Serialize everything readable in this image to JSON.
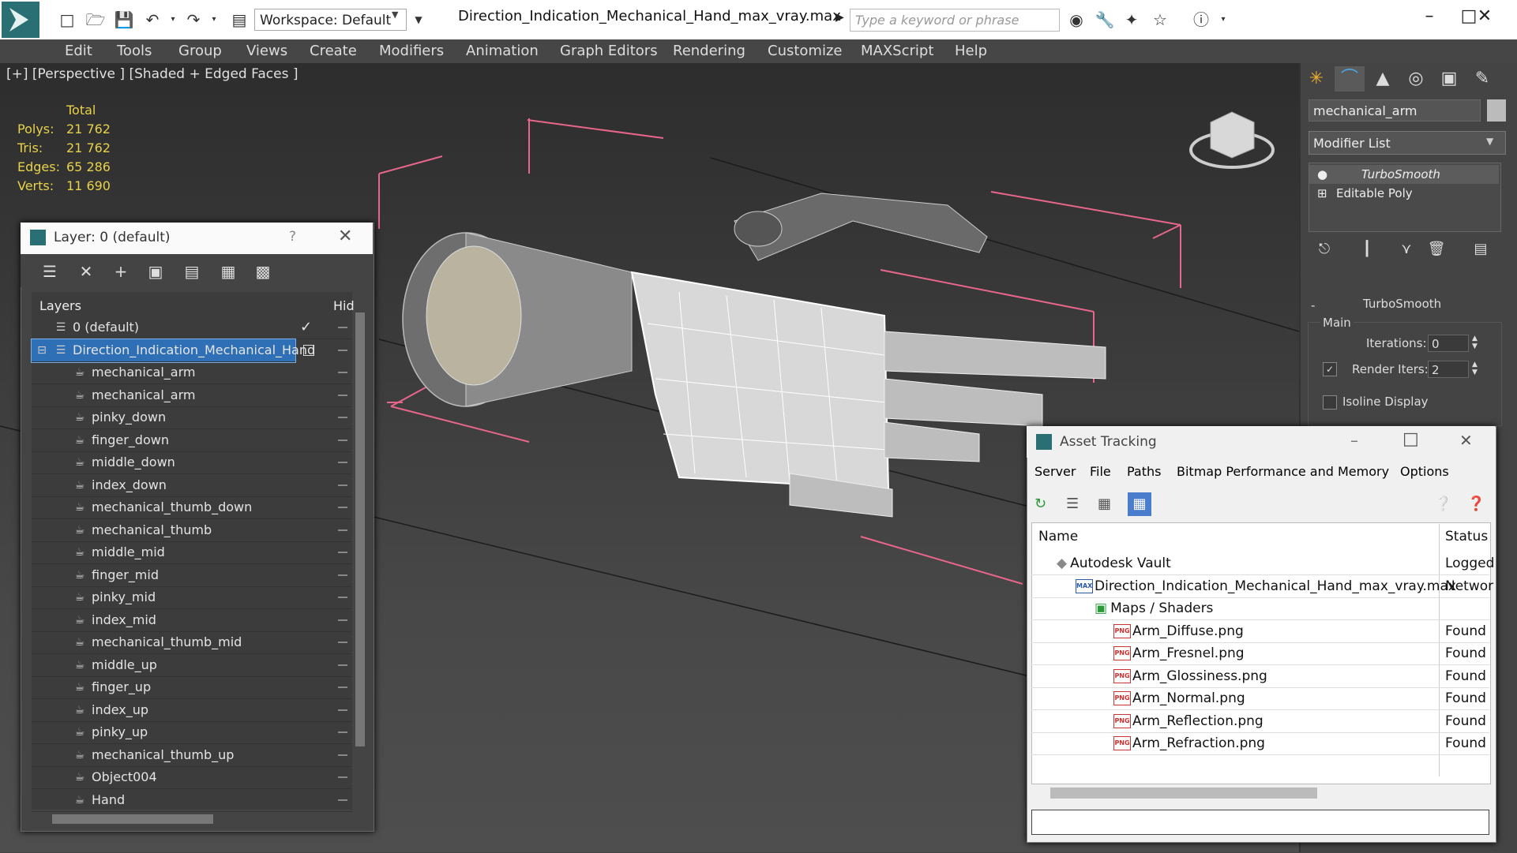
{
  "app": {
    "document_title": "Direction_Indication_Mechanical_Hand_max_vray.max",
    "workspace": "Workspace: Default",
    "search_placeholder": "Type a keyword or phrase"
  },
  "menu": [
    "Edit",
    "Tools",
    "Group",
    "Views",
    "Create",
    "Modifiers",
    "Animation",
    "Graph Editors",
    "Rendering",
    "Customize",
    "MAXScript",
    "Help"
  ],
  "viewport": {
    "label": "[+] [Perspective ] [Shaded + Edged Faces ]",
    "stats": {
      "header": "Total",
      "rows": [
        {
          "label": "Polys:",
          "value": "21 762"
        },
        {
          "label": "Tris:",
          "value": "21 762"
        },
        {
          "label": "Edges:",
          "value": "65 286"
        },
        {
          "label": "Verts:",
          "value": "11 690"
        }
      ]
    }
  },
  "command_panel": {
    "object_name": "mechanical_arm",
    "modifier_list": "Modifier List",
    "stack": [
      "TurboSmooth",
      "Editable Poly"
    ],
    "rollout_title": "TurboSmooth",
    "group": "Main",
    "iterations_label": "Iterations:",
    "iterations_value": "0",
    "render_iters_label": "Render Iters:",
    "render_iters_value": "2",
    "isoline_label": "Isoline Display"
  },
  "layer_window": {
    "title": "Layer: 0 (default)",
    "help": "?",
    "col_layers": "Layers",
    "col_hide": "Hid",
    "rows": [
      {
        "name": "0 (default)",
        "level": 0,
        "type": "layer"
      },
      {
        "name": "Direction_Indication_Mechanical_Hand",
        "level": 0,
        "type": "layer",
        "selected": true
      },
      {
        "name": "mechanical_arm",
        "level": 1,
        "type": "object"
      },
      {
        "name": "mechanical_arm",
        "level": 1,
        "type": "object"
      },
      {
        "name": "pinky_down",
        "level": 1,
        "type": "object"
      },
      {
        "name": "finger_down",
        "level": 1,
        "type": "object"
      },
      {
        "name": "middle_down",
        "level": 1,
        "type": "object"
      },
      {
        "name": "index_down",
        "level": 1,
        "type": "object"
      },
      {
        "name": "mechanical_thumb_down",
        "level": 1,
        "type": "object"
      },
      {
        "name": "mechanical_thumb",
        "level": 1,
        "type": "object"
      },
      {
        "name": "middle_mid",
        "level": 1,
        "type": "object"
      },
      {
        "name": "finger_mid",
        "level": 1,
        "type": "object"
      },
      {
        "name": "pinky_mid",
        "level": 1,
        "type": "object"
      },
      {
        "name": "index_mid",
        "level": 1,
        "type": "object"
      },
      {
        "name": "mechanical_thumb_mid",
        "level": 1,
        "type": "object"
      },
      {
        "name": "middle_up",
        "level": 1,
        "type": "object"
      },
      {
        "name": "finger_up",
        "level": 1,
        "type": "object"
      },
      {
        "name": "index_up",
        "level": 1,
        "type": "object"
      },
      {
        "name": "pinky_up",
        "level": 1,
        "type": "object"
      },
      {
        "name": "mechanical_thumb_up",
        "level": 1,
        "type": "object"
      },
      {
        "name": "Object004",
        "level": 1,
        "type": "object"
      },
      {
        "name": "Hand",
        "level": 1,
        "type": "object"
      }
    ]
  },
  "asset_window": {
    "title": "Asset Tracking",
    "menu": [
      "Server",
      "File",
      "Paths",
      "Bitmap Performance and Memory",
      "Options"
    ],
    "col_name": "Name",
    "col_status": "Status",
    "rows": [
      {
        "name": "Autodesk Vault",
        "status": "Logged",
        "level": 0,
        "icon": "vault"
      },
      {
        "name": "Direction_Indication_Mechanical_Hand_max_vray.max",
        "status": "Networ",
        "level": 1,
        "icon": "max"
      },
      {
        "name": "Maps / Shaders",
        "status": "",
        "level": 2,
        "icon": "maps"
      },
      {
        "name": "Arm_Diffuse.png",
        "status": "Found",
        "level": 3,
        "icon": "png"
      },
      {
        "name": "Arm_Fresnel.png",
        "status": "Found",
        "level": 3,
        "icon": "png"
      },
      {
        "name": "Arm_Glossiness.png",
        "status": "Found",
        "level": 3,
        "icon": "png"
      },
      {
        "name": "Arm_Normal.png",
        "status": "Found",
        "level": 3,
        "icon": "png"
      },
      {
        "name": "Arm_Reflection.png",
        "status": "Found",
        "level": 3,
        "icon": "png"
      },
      {
        "name": "Arm_Refraction.png",
        "status": "Found",
        "level": 3,
        "icon": "png"
      }
    ]
  },
  "icon_labels": {
    "png": "PNG",
    "max": "MAX"
  }
}
